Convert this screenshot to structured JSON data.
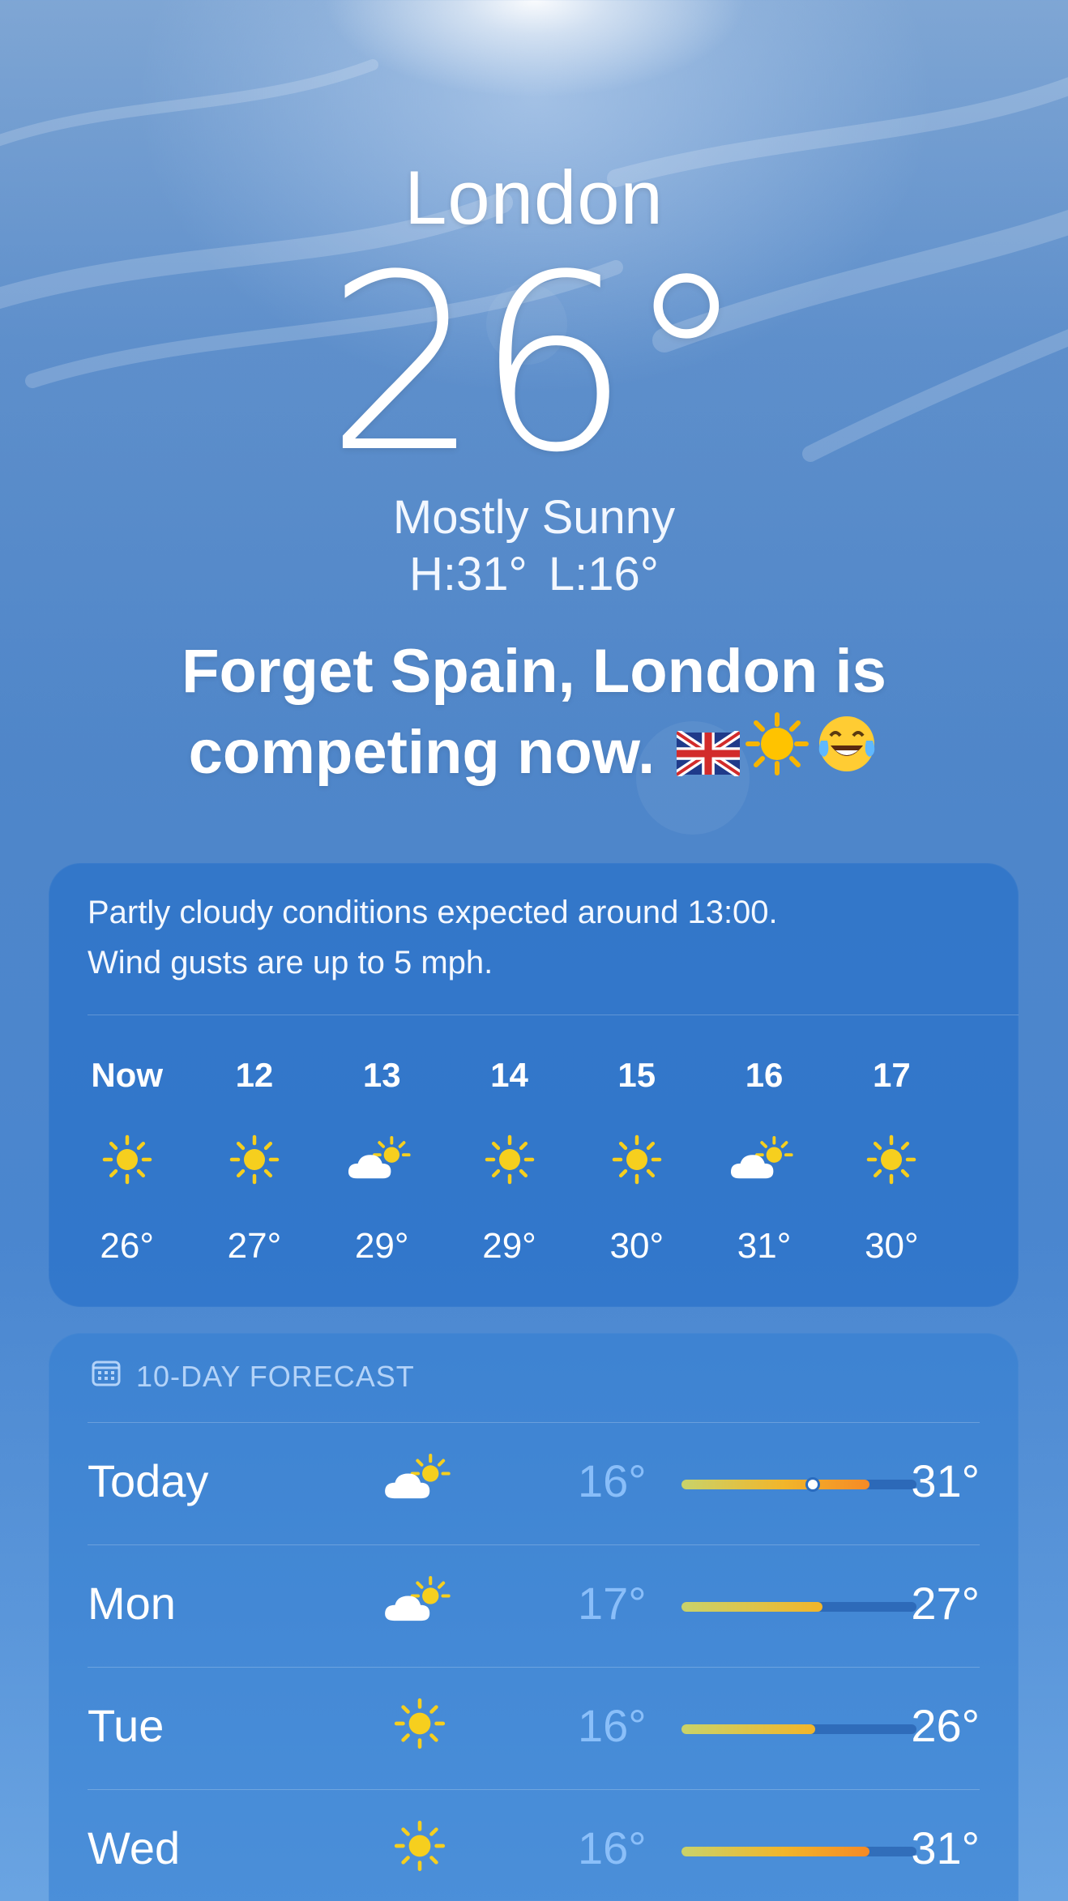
{
  "location": {
    "city": "London",
    "temperature": "26°",
    "condition": "Mostly Sunny",
    "high_low": "H:31°  L:16°"
  },
  "message": {
    "line1": "Forget Spain, London is",
    "line2": "competing now."
  },
  "hourly": {
    "summary_line1": "Partly cloudy conditions expected around 13:00.",
    "summary_line2": "Wind gusts are up to 5 mph.",
    "items": [
      {
        "label": "Now",
        "icon": "sun-icon",
        "temp": "26°"
      },
      {
        "label": "12",
        "icon": "sun-icon",
        "temp": "27°"
      },
      {
        "label": "13",
        "icon": "partly-cloudy-icon",
        "temp": "29°"
      },
      {
        "label": "14",
        "icon": "sun-icon",
        "temp": "29°"
      },
      {
        "label": "15",
        "icon": "sun-icon",
        "temp": "30°"
      },
      {
        "label": "16",
        "icon": "partly-cloudy-icon",
        "temp": "31°"
      },
      {
        "label": "17",
        "icon": "sun-icon",
        "temp": "30°"
      }
    ]
  },
  "forecast": {
    "header": "10-DAY FORECAST",
    "days": [
      {
        "name": "Today",
        "icon": "partly-cloudy-icon",
        "low": "16°",
        "high": "31°",
        "range_start": 0.0,
        "range_end": 0.8,
        "current_marker": 0.56
      },
      {
        "name": "Mon",
        "icon": "partly-cloudy-icon",
        "low": "17°",
        "high": "27°",
        "range_start": 0.0,
        "range_end": 0.6
      },
      {
        "name": "Tue",
        "icon": "sun-icon",
        "low": "16°",
        "high": "26°",
        "range_start": 0.0,
        "range_end": 0.57
      },
      {
        "name": "Wed",
        "icon": "sun-icon",
        "low": "16°",
        "high": "31°",
        "range_start": 0.0,
        "range_end": 0.8
      }
    ]
  },
  "colors": {
    "sun": "#f6cf1e",
    "bar_low": "#c9d36a",
    "bar_mid": "#f2b52a",
    "bar_high": "#f58a26"
  }
}
